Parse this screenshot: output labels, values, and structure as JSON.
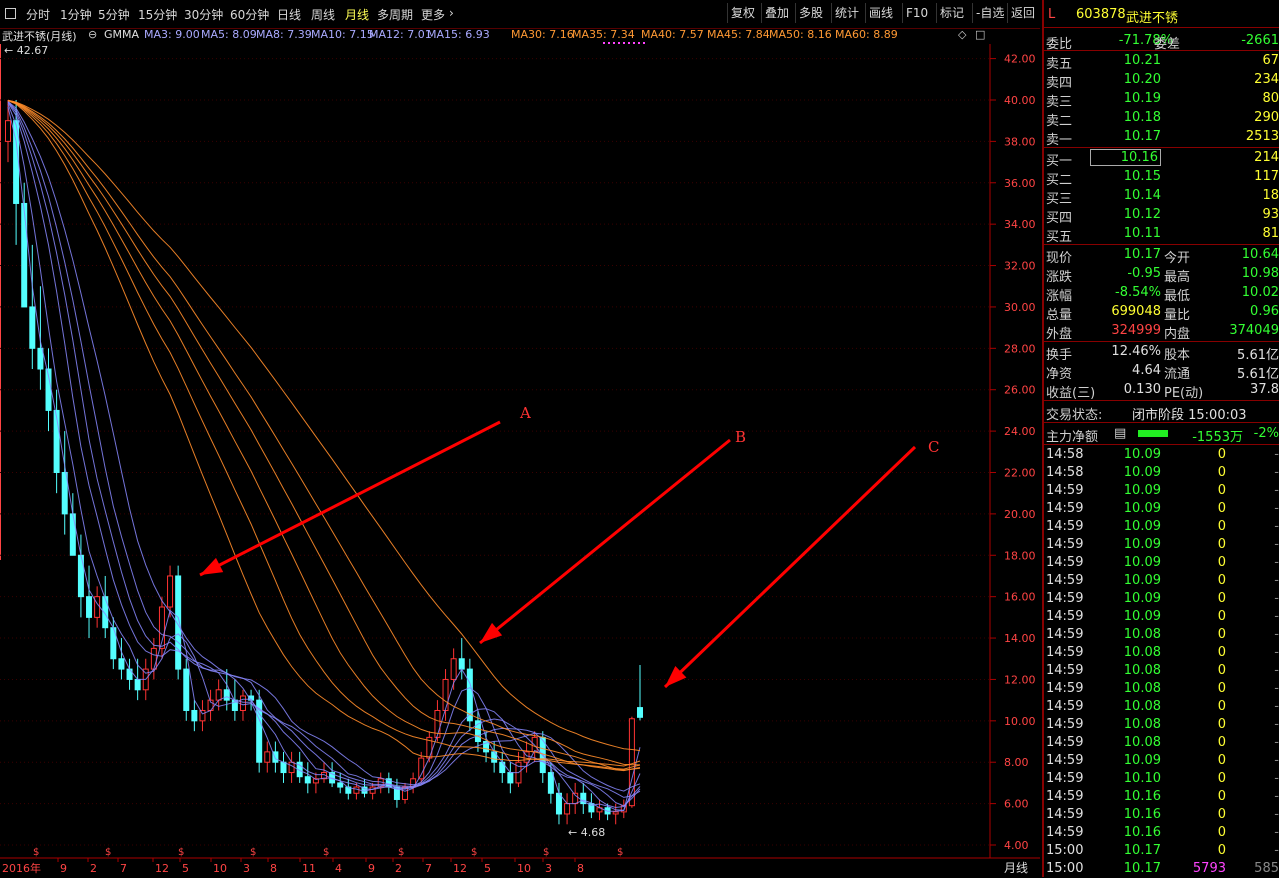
{
  "toolbar": {
    "tabs": [
      "分时",
      "1分钟",
      "5分钟",
      "15分钟",
      "30分钟",
      "60分钟",
      "日线",
      "周线",
      "月线",
      "多周期",
      "更多"
    ],
    "active_tab": "月线",
    "right_buttons": [
      "复权",
      "叠加",
      "多股",
      "统计",
      "画线",
      "F10",
      "标记",
      "-自选",
      "返回"
    ]
  },
  "chart": {
    "title": "武进不锈(月线)",
    "indicator": "GMMA",
    "ma_labels": [
      {
        "text": "MA3: 9.00",
        "color": "#aaaaff"
      },
      {
        "text": "MA5: 8.09",
        "color": "#aaaaff"
      },
      {
        "text": "MA8: 7.39",
        "color": "#aaaaff"
      },
      {
        "text": "MA10: 7.15",
        "color": "#aaaaff"
      },
      {
        "text": "MA12: 7.01",
        "color": "#aaaaff"
      },
      {
        "text": "MA15: 6.93",
        "color": "#aaaaff"
      },
      {
        "text": "MA30: 7.16",
        "color": "#ff9933"
      },
      {
        "text": "MA35: 7.34",
        "color": "#ff9933"
      },
      {
        "text": "MA40: 7.57",
        "color": "#ff9933"
      },
      {
        "text": "MA45: 7.84",
        "color": "#ff9933"
      },
      {
        "text": "MA50: 8.16",
        "color": "#ff9933"
      },
      {
        "text": "MA60: 8.89",
        "color": "#ff9933"
      }
    ],
    "max_label": "42.67",
    "min_label": "4.68",
    "annotations": [
      "A",
      "B",
      "C"
    ],
    "period_label": "月线",
    "x_start": "2016年",
    "x_ticks": [
      "9",
      "2",
      "7",
      "12",
      "5",
      "10",
      "3",
      "8",
      "11",
      "4",
      "9",
      "2",
      "7",
      "12",
      "5",
      "10",
      "3",
      "8"
    ]
  },
  "chart_data": {
    "type": "candlestick",
    "title": "武进不锈(月线)",
    "ylim": [
      4,
      43
    ],
    "yticks": [
      4,
      6,
      8,
      10,
      12,
      14,
      16,
      18,
      20,
      22,
      24,
      26,
      28,
      30,
      32,
      34,
      36,
      38,
      40,
      42
    ],
    "candles": [
      [
        38,
        40,
        37,
        39
      ],
      [
        39,
        40,
        33,
        35
      ],
      [
        35,
        36,
        30,
        30
      ],
      [
        30,
        33,
        27,
        28
      ],
      [
        28,
        31,
        26,
        27
      ],
      [
        27,
        28,
        24,
        25
      ],
      [
        25,
        26,
        21,
        22
      ],
      [
        22,
        24,
        19,
        20
      ],
      [
        20,
        21,
        18,
        18
      ],
      [
        18,
        19,
        15,
        16
      ],
      [
        16,
        17.5,
        14,
        15
      ],
      [
        15,
        16.5,
        14.5,
        16
      ],
      [
        16,
        17,
        14,
        14.5
      ],
      [
        14.5,
        15,
        12.5,
        13
      ],
      [
        13,
        14,
        12,
        12.5
      ],
      [
        12.5,
        13,
        11.5,
        12
      ],
      [
        12,
        13,
        11,
        11.5
      ],
      [
        11.5,
        13,
        11,
        12.5
      ],
      [
        12.5,
        14,
        12,
        13.5
      ],
      [
        13.5,
        16,
        13,
        15.5
      ],
      [
        15.5,
        17.5,
        15,
        17
      ],
      [
        17,
        17.5,
        12,
        12.5
      ],
      [
        12.5,
        13,
        10,
        10.5
      ],
      [
        10.5,
        11,
        9.5,
        10
      ],
      [
        10,
        11,
        9.5,
        10.5
      ],
      [
        10.5,
        11.5,
        10,
        11
      ],
      [
        11,
        12,
        10.5,
        11.5
      ],
      [
        11.5,
        12.5,
        10.5,
        11
      ],
      [
        11,
        12,
        10,
        10.5
      ],
      [
        10.5,
        11.5,
        10,
        11.2
      ],
      [
        11.2,
        11.5,
        10.5,
        11
      ],
      [
        11,
        11.5,
        7.5,
        8
      ],
      [
        8,
        9,
        7.5,
        8.5
      ],
      [
        8.5,
        9,
        7.5,
        8
      ],
      [
        8,
        8.5,
        7,
        7.5
      ],
      [
        7.5,
        8.5,
        7,
        8
      ],
      [
        8,
        8.5,
        7,
        7.3
      ],
      [
        7.3,
        8,
        6.5,
        7
      ],
      [
        7,
        7.5,
        6.5,
        7.2
      ],
      [
        7.2,
        8,
        7,
        7.5
      ],
      [
        7.5,
        8,
        6.8,
        7
      ],
      [
        7,
        7.5,
        6.5,
        6.8
      ],
      [
        6.8,
        7.2,
        6.2,
        6.5
      ],
      [
        6.5,
        7,
        6.2,
        6.8
      ],
      [
        6.8,
        7.2,
        6.3,
        6.5
      ],
      [
        6.5,
        7,
        6.2,
        6.8
      ],
      [
        6.8,
        7.5,
        6.5,
        7.2
      ],
      [
        7.2,
        7.5,
        6.5,
        6.8
      ],
      [
        6.8,
        7.2,
        5.8,
        6.2
      ],
      [
        6.2,
        7,
        6,
        6.8
      ],
      [
        6.8,
        7.5,
        6.5,
        7.2
      ],
      [
        7.2,
        8.5,
        7,
        8.2
      ],
      [
        8.2,
        9.5,
        8,
        9.2
      ],
      [
        9.2,
        11,
        9,
        10.5
      ],
      [
        10.5,
        12.5,
        10,
        12
      ],
      [
        12,
        13.5,
        11.5,
        13
      ],
      [
        13,
        14,
        12,
        12.5
      ],
      [
        12.5,
        13,
        9.5,
        10
      ],
      [
        10,
        10.5,
        8.5,
        9
      ],
      [
        9,
        9.5,
        8,
        8.5
      ],
      [
        8.5,
        9,
        7.5,
        8
      ],
      [
        8,
        8.5,
        7,
        7.5
      ],
      [
        7.5,
        8,
        6.5,
        7
      ],
      [
        7,
        8.5,
        6.8,
        8
      ],
      [
        8,
        9,
        7.5,
        8.5
      ],
      [
        8.5,
        9.5,
        8,
        9.2
      ],
      [
        9.2,
        9.5,
        7,
        7.5
      ],
      [
        7.5,
        8,
        6,
        6.5
      ],
      [
        6.5,
        7,
        5,
        5.5
      ],
      [
        5.5,
        6.5,
        5,
        6
      ],
      [
        6,
        7,
        5.5,
        6.5
      ],
      [
        6.5,
        7,
        5.5,
        6
      ],
      [
        6,
        6.5,
        5.3,
        5.6
      ],
      [
        5.6,
        6.2,
        5.2,
        5.8
      ],
      [
        5.8,
        6,
        5.2,
        5.5
      ],
      [
        5.5,
        6,
        5,
        5.6
      ],
      [
        5.6,
        6.2,
        5.3,
        5.9
      ],
      [
        5.9,
        10.2,
        5.8,
        10.1
      ],
      [
        10.64,
        12.7,
        10.02,
        10.17
      ]
    ]
  },
  "panel": {
    "code": "603878",
    "name": "武进不锈",
    "marker": "L",
    "weibi_label": "委比",
    "weibi": "-71.78%",
    "weicha_label": "委差",
    "weicha": "-2661",
    "asks": [
      {
        "label": "卖五",
        "price": "10.21",
        "vol": "67"
      },
      {
        "label": "卖四",
        "price": "10.20",
        "vol": "234"
      },
      {
        "label": "卖三",
        "price": "10.19",
        "vol": "80"
      },
      {
        "label": "卖二",
        "price": "10.18",
        "vol": "290"
      },
      {
        "label": "卖一",
        "price": "10.17",
        "vol": "2513"
      }
    ],
    "bids": [
      {
        "label": "买一",
        "price": "10.16",
        "vol": "214"
      },
      {
        "label": "买二",
        "price": "10.15",
        "vol": "117"
      },
      {
        "label": "买三",
        "price": "10.14",
        "vol": "18"
      },
      {
        "label": "买四",
        "price": "10.12",
        "vol": "93"
      },
      {
        "label": "买五",
        "price": "10.11",
        "vol": "81"
      }
    ],
    "quote": [
      {
        "l1": "现价",
        "v1": "10.17",
        "c1": "g",
        "l2": "今开",
        "v2": "10.64",
        "c2": "g"
      },
      {
        "l1": "涨跌",
        "v1": "-0.95",
        "c1": "g",
        "l2": "最高",
        "v2": "10.98",
        "c2": "g"
      },
      {
        "l1": "涨幅",
        "v1": "-8.54%",
        "c1": "g",
        "l2": "最低",
        "v2": "10.02",
        "c2": "g"
      },
      {
        "l1": "总量",
        "v1": "699048",
        "c1": "y",
        "l2": "量比",
        "v2": "0.96",
        "c2": "g"
      },
      {
        "l1": "外盘",
        "v1": "324999",
        "c1": "r",
        "l2": "内盘",
        "v2": "374049",
        "c2": "g"
      }
    ],
    "fund": [
      {
        "l1": "换手",
        "v1": "12.46%",
        "l2": "股本",
        "v2": "5.61亿"
      },
      {
        "l1": "净资",
        "v1": "4.64",
        "l2": "流通",
        "v2": "5.61亿"
      },
      {
        "l1": "收益(三)",
        "v1": "0.130",
        "l2": "PE(动)",
        "v2": "37.8"
      }
    ],
    "status_label": "交易状态:",
    "status_value": "闭市阶段 15:00:03",
    "main_label": "主力净额",
    "main_value": "-1553万",
    "main_pct": "-2%",
    "ticks": [
      {
        "t": "14:58",
        "p": "10.09",
        "v": "0",
        "d": "-"
      },
      {
        "t": "14:58",
        "p": "10.09",
        "v": "0",
        "d": "-"
      },
      {
        "t": "14:59",
        "p": "10.09",
        "v": "0",
        "d": "-"
      },
      {
        "t": "14:59",
        "p": "10.09",
        "v": "0",
        "d": "-"
      },
      {
        "t": "14:59",
        "p": "10.09",
        "v": "0",
        "d": "-"
      },
      {
        "t": "14:59",
        "p": "10.09",
        "v": "0",
        "d": "-"
      },
      {
        "t": "14:59",
        "p": "10.09",
        "v": "0",
        "d": "-"
      },
      {
        "t": "14:59",
        "p": "10.09",
        "v": "0",
        "d": "-"
      },
      {
        "t": "14:59",
        "p": "10.09",
        "v": "0",
        "d": "-"
      },
      {
        "t": "14:59",
        "p": "10.09",
        "v": "0",
        "d": "-"
      },
      {
        "t": "14:59",
        "p": "10.08",
        "v": "0",
        "d": "-"
      },
      {
        "t": "14:59",
        "p": "10.08",
        "v": "0",
        "d": "-"
      },
      {
        "t": "14:59",
        "p": "10.08",
        "v": "0",
        "d": "-"
      },
      {
        "t": "14:59",
        "p": "10.08",
        "v": "0",
        "d": "-"
      },
      {
        "t": "14:59",
        "p": "10.08",
        "v": "0",
        "d": "-"
      },
      {
        "t": "14:59",
        "p": "10.08",
        "v": "0",
        "d": "-"
      },
      {
        "t": "14:59",
        "p": "10.08",
        "v": "0",
        "d": "-"
      },
      {
        "t": "14:59",
        "p": "10.09",
        "v": "0",
        "d": "-"
      },
      {
        "t": "14:59",
        "p": "10.10",
        "v": "0",
        "d": "-"
      },
      {
        "t": "14:59",
        "p": "10.16",
        "v": "0",
        "d": "-"
      },
      {
        "t": "14:59",
        "p": "10.16",
        "v": "0",
        "d": "-"
      },
      {
        "t": "14:59",
        "p": "10.16",
        "v": "0",
        "d": "-"
      },
      {
        "t": "15:00",
        "p": "10.17",
        "v": "0",
        "d": "-"
      },
      {
        "t": "15:00",
        "p": "10.17",
        "v": "5793",
        "d": "585"
      }
    ],
    "colors": {
      "up": "#ff3333",
      "down": "#54ffff",
      "border": "#880000"
    }
  }
}
